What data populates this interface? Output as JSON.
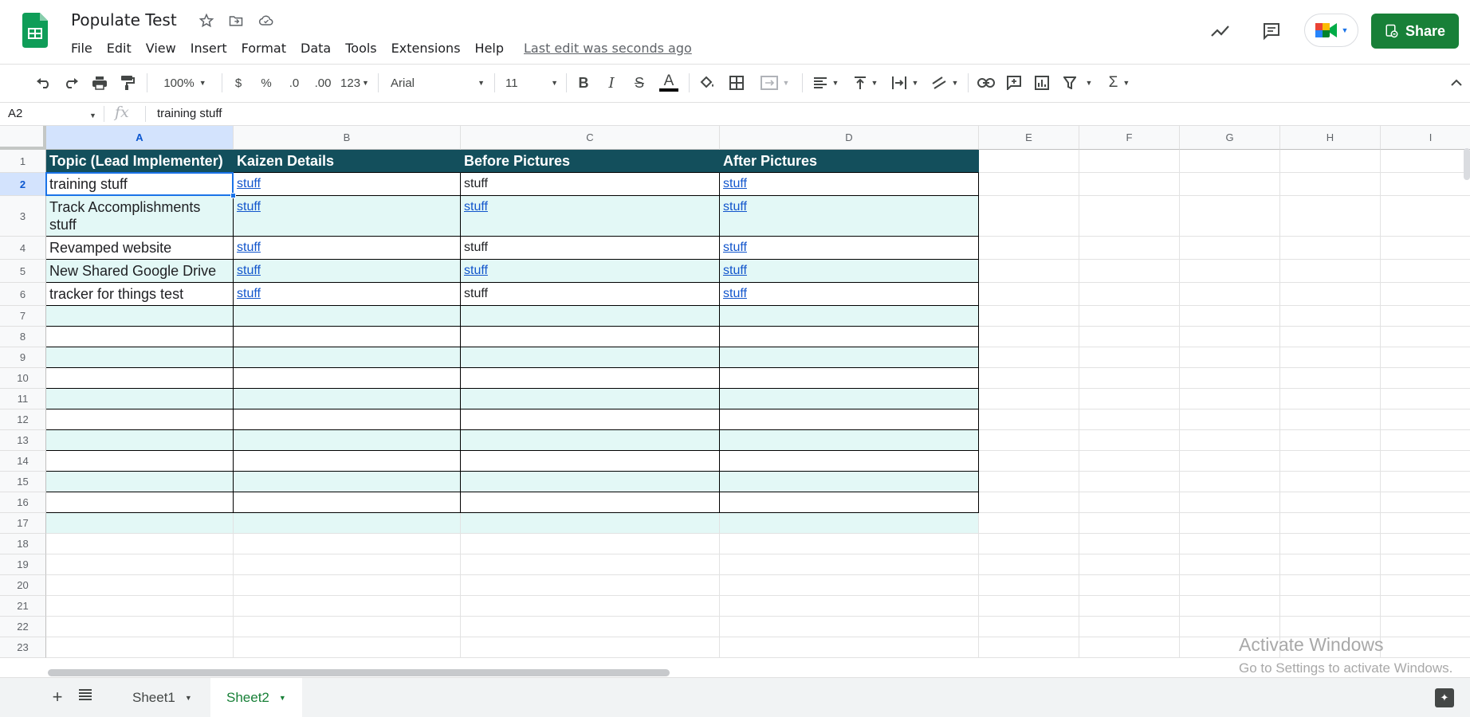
{
  "doc": {
    "title": "Populate Test",
    "last_edit": "Last edit was seconds ago"
  },
  "menu": [
    "File",
    "Edit",
    "View",
    "Insert",
    "Format",
    "Data",
    "Tools",
    "Extensions",
    "Help"
  ],
  "share": {
    "label": "Share"
  },
  "toolbar": {
    "zoom": "100%",
    "currency": "$",
    "percent": "%",
    "dec_decrease": ".0",
    "dec_increase": ".00",
    "more_formats": "123",
    "font": "Arial",
    "font_size": "11",
    "bold": "B",
    "italic": "I",
    "strike": "S",
    "text_color": "A",
    "sum": "Σ"
  },
  "formula": {
    "cell_ref": "A2",
    "fx": "fx",
    "value": "training stuff"
  },
  "columns": [
    "A",
    "B",
    "C",
    "D",
    "E",
    "F",
    "G",
    "H",
    "I"
  ],
  "rows": [
    "1",
    "2",
    "3",
    "4",
    "5",
    "6",
    "7",
    "8",
    "9",
    "10",
    "11",
    "12",
    "13",
    "14",
    "15",
    "16",
    "17",
    "18",
    "19",
    "20",
    "21",
    "22",
    "23"
  ],
  "table": {
    "headers": [
      "Topic (Lead Implementer)",
      "Kaizen Details",
      "Before Pictures",
      "After Pictures"
    ],
    "data": [
      [
        "training stuff",
        "stuff",
        "stuff",
        "stuff"
      ],
      [
        "Track Accomplishments stuff",
        "stuff",
        "stuff",
        "stuff"
      ],
      [
        "Revamped website",
        "stuff",
        "stuff",
        "stuff"
      ],
      [
        "New Shared Google Drive",
        "stuff",
        "stuff",
        "stuff"
      ],
      [
        "tracker for things test",
        "stuff",
        "stuff",
        "stuff"
      ]
    ],
    "linked": [
      [
        false,
        true,
        false,
        true
      ],
      [
        false,
        true,
        true,
        true
      ],
      [
        false,
        true,
        false,
        true
      ],
      [
        false,
        true,
        true,
        true
      ],
      [
        false,
        true,
        false,
        true
      ]
    ]
  },
  "sheets": [
    "Sheet1",
    "Sheet2"
  ],
  "active_sheet": "Sheet2",
  "watermark": {
    "title": "Activate Windows",
    "subtitle": "Go to Settings to activate Windows."
  },
  "colors": {
    "header_bg": "#134f5c",
    "band_bg": "#e3f8f6",
    "share_green": "#188038",
    "link": "#1155cc",
    "selection": "#1a73e8"
  }
}
